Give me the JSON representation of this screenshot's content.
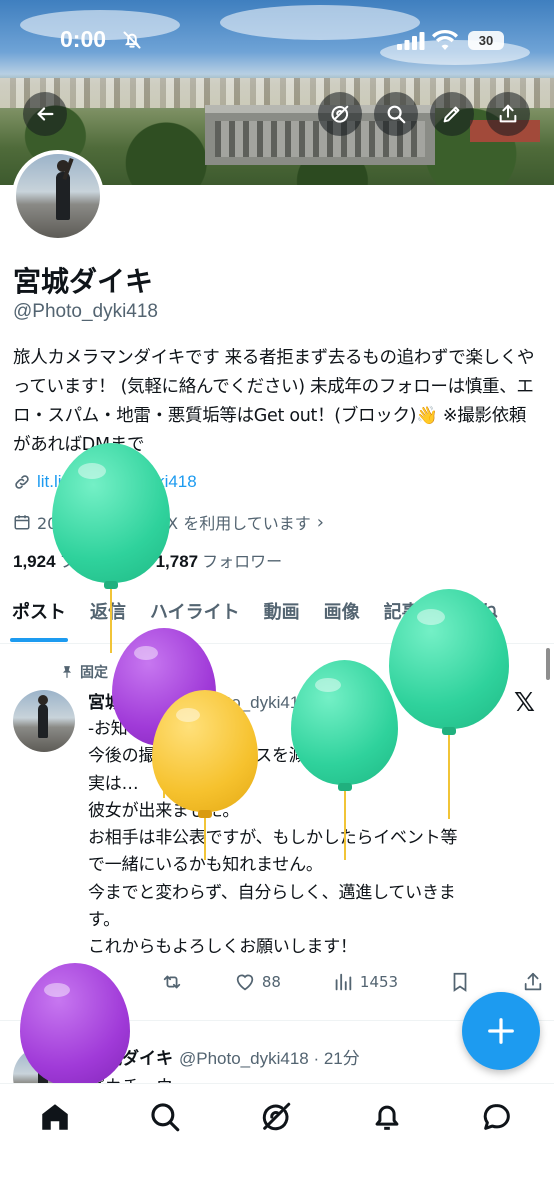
{
  "status_bar": {
    "time": "0:00",
    "battery": "30"
  },
  "profile": {
    "name": "宮城ダイキ",
    "handle": "@Photo_dyki418",
    "bio": "旅人カメラマンダイキです 来る者拒まず去るもの追わずで楽しくやっています！ (気軽に絡んでください) 未成年のフォローは慎重、エロ・スパム・地雷・悪質垢等はGet out！(ブロック)👋 ※撮影依頼があればDMまで",
    "link": "lit.link/Photo_dyki418",
    "joined": "2021年11月から X を利用しています",
    "following_count": "1,924",
    "following_label": "フォロー中",
    "followers_count": "1,787",
    "followers_label": "フォロワー"
  },
  "tabs": [
    "ポスト",
    "返信",
    "ハイライト",
    "動画",
    "画像",
    "記事",
    "いいね"
  ],
  "pinned_post": {
    "pinned_label": "固定",
    "author": "宮城ダイキ",
    "handle_time": "@Photo_dyki418 · 3日",
    "lines": [
      "-お知らせ-",
      "今後の撮影ですがペースを減らします。",
      "実は…",
      "彼女が出来ました。",
      "お相手は非公表ですが、もしかしたらイベント等",
      "で一緒にいるかも知れません。",
      "今までと変わらず、自分らしく、邁進していきま",
      "す。",
      "これからもよろしくお願いします！"
    ],
    "likes": "88",
    "views": "1453"
  },
  "second_post": {
    "author": "宮城ダイキ",
    "handle_time": "@Photo_dyki418 · 21分",
    "preview": "ピカチュウ"
  },
  "colors": {
    "accent": "#1d9bf0",
    "balloon_green": "#3ddca6",
    "balloon_purple": "#a03ad8",
    "balloon_yellow": "#f6c22e"
  },
  "icons": [
    "back-arrow-icon",
    "grok-icon",
    "search-icon",
    "edit-icon",
    "share-icon",
    "link-icon",
    "calendar-icon",
    "pin-icon",
    "x-logo-icon",
    "reply-icon",
    "retweet-icon",
    "like-icon",
    "views-icon",
    "bookmark-icon",
    "upload-icon",
    "plus-icon",
    "home-icon",
    "bell-icon",
    "messages-icon"
  ]
}
